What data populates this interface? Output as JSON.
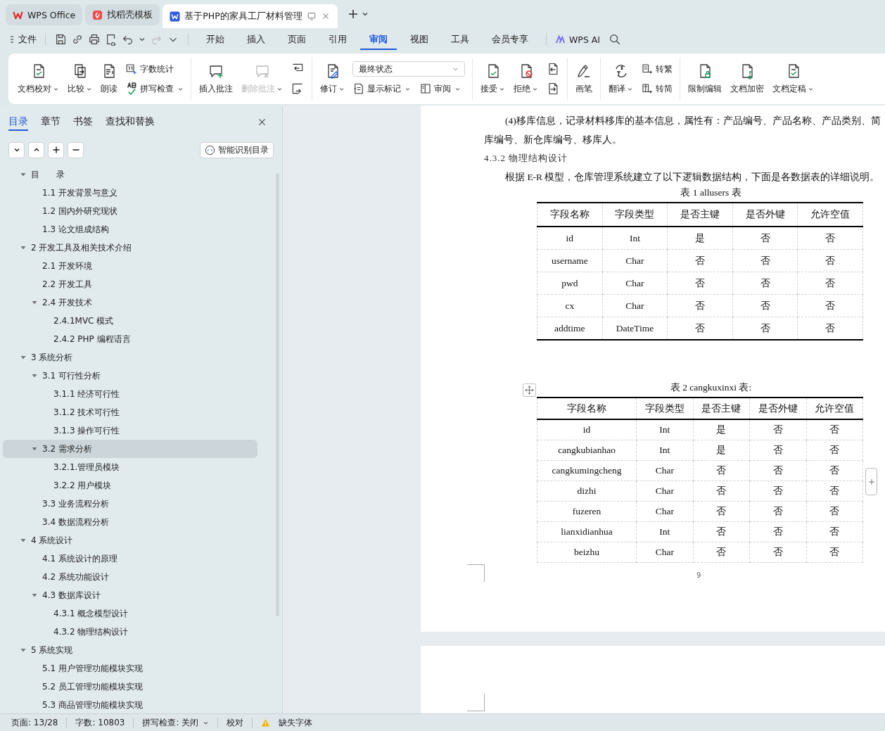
{
  "window_tabs": [
    {
      "label": "WPS Office",
      "kind": "home",
      "selected": false
    },
    {
      "label": "找稻壳模板",
      "kind": "template",
      "selected": false
    },
    {
      "label": "基于PHP的家具工厂材料管理",
      "kind": "document",
      "selected": true
    }
  ],
  "menu": {
    "file": "文件",
    "tabs": [
      {
        "label": "开始",
        "selected": false
      },
      {
        "label": "插入",
        "selected": false
      },
      {
        "label": "页面",
        "selected": false
      },
      {
        "label": "引用",
        "selected": false
      },
      {
        "label": "审阅",
        "selected": true
      },
      {
        "label": "视图",
        "selected": false
      },
      {
        "label": "工具",
        "selected": false
      },
      {
        "label": "会员专享",
        "selected": false
      }
    ],
    "ai": "WPS AI"
  },
  "ribbon": [
    {
      "items": [
        {
          "kind": "big",
          "label": "文档校对",
          "caret": true,
          "disabled": false
        },
        {
          "kind": "big",
          "label": "比较",
          "caret": true,
          "disabled": false
        },
        {
          "kind": "big",
          "label": "朗读",
          "caret": false,
          "disabled": false
        },
        {
          "kind": "small",
          "label": "字数统计",
          "caret": false,
          "disabled": false
        },
        {
          "kind": "small",
          "label": "拼写检查",
          "caret": true,
          "disabled": false
        }
      ]
    },
    {
      "items": [
        {
          "kind": "big",
          "label": "插入批注",
          "caret": false,
          "disabled": false
        },
        {
          "kind": "big",
          "label": "删除批注",
          "caret": true,
          "disabled": true
        },
        {
          "kind": "icon",
          "disabled": false
        },
        {
          "kind": "icon",
          "disabled": false
        }
      ]
    },
    {
      "items": [
        {
          "kind": "big",
          "label": "修订",
          "caret": true,
          "disabled": false
        },
        {
          "kind": "select",
          "label": "最终状态",
          "caret": true,
          "disabled": false
        },
        {
          "kind": "small",
          "label": "显示标记",
          "caret": true,
          "disabled": false
        },
        {
          "kind": "small",
          "label": "审阅",
          "caret": true,
          "disabled": false
        }
      ]
    },
    {
      "items": [
        {
          "kind": "big",
          "label": "接受",
          "caret": true,
          "disabled": false
        },
        {
          "kind": "big",
          "label": "拒绝",
          "caret": true,
          "disabled": false
        },
        {
          "kind": "icon",
          "disabled": false
        },
        {
          "kind": "icon",
          "disabled": false
        }
      ]
    },
    {
      "items": [
        {
          "kind": "big",
          "label": "画笔",
          "caret": false,
          "disabled": false
        }
      ]
    },
    {
      "items": [
        {
          "kind": "big",
          "label": "翻译",
          "caret": true,
          "disabled": false
        },
        {
          "kind": "small",
          "label": "转繁",
          "caret": false,
          "disabled": false
        },
        {
          "kind": "small",
          "label": "转简",
          "caret": false,
          "disabled": false
        }
      ]
    },
    {
      "items": [
        {
          "kind": "big",
          "label": "限制编辑",
          "caret": false,
          "disabled": false
        },
        {
          "kind": "big",
          "label": "文档加密",
          "caret": false,
          "disabled": false
        },
        {
          "kind": "big",
          "label": "文档定稿",
          "caret": true,
          "disabled": false
        }
      ]
    }
  ],
  "panel": {
    "tabs": [
      {
        "label": "目录",
        "selected": true
      },
      {
        "label": "章节",
        "selected": false
      },
      {
        "label": "书签",
        "selected": false
      },
      {
        "label": "查找和替换",
        "selected": false
      }
    ],
    "smart_button": "智能识别目录",
    "outline": [
      {
        "label": "目　　录",
        "expanded": true,
        "selected": false,
        "children": [
          {
            "label": "1.1 开发背景与意义",
            "selected": false
          },
          {
            "label": "1.2 国内外研究现状",
            "selected": false
          },
          {
            "label": "1.3 论文组成结构",
            "selected": false
          }
        ]
      },
      {
        "label": "2 开发工具及相关技术介绍",
        "expanded": true,
        "selected": false,
        "children": [
          {
            "label": "2.1 开发环境",
            "selected": false
          },
          {
            "label": "2.2 开发工具",
            "selected": false
          },
          {
            "label": "2.4 开发技术",
            "expanded": true,
            "selected": false,
            "children": [
              {
                "label": "2.4.1MVC 模式",
                "selected": false
              },
              {
                "label": "2.4.2 PHP 编程语言",
                "selected": false
              }
            ]
          }
        ]
      },
      {
        "label": "3 系统分析",
        "expanded": true,
        "selected": false,
        "children": [
          {
            "label": "3.1 可行性分析",
            "expanded": true,
            "selected": false,
            "children": [
              {
                "label": "3.1.1 经济可行性",
                "selected": false
              },
              {
                "label": "3.1.2 技术可行性",
                "selected": false
              },
              {
                "label": "3.1.3 操作可行性",
                "selected": false
              }
            ]
          },
          {
            "label": "3.2 需求分析",
            "expanded": true,
            "selected": true,
            "children": [
              {
                "label": "3.2.1.管理员模块",
                "selected": false
              },
              {
                "label": "3.2.2 用户模块",
                "selected": false
              }
            ]
          },
          {
            "label": "3.3 业务流程分析",
            "selected": false
          },
          {
            "label": "3.4 数据流程分析",
            "selected": false
          }
        ]
      },
      {
        "label": "4 系统设计",
        "expanded": true,
        "selected": false,
        "children": [
          {
            "label": "4.1 系统设计的原理",
            "selected": false
          },
          {
            "label": "4.2 系统功能设计",
            "selected": false
          },
          {
            "label": "4.3 数据库设计",
            "expanded": true,
            "selected": false,
            "children": [
              {
                "label": "4.3.1 概念模型设计",
                "selected": false
              },
              {
                "label": "4.3.2 物理结构设计",
                "selected": false
              }
            ]
          }
        ]
      },
      {
        "label": "5 系统实现",
        "expanded": true,
        "selected": false,
        "children": [
          {
            "label": "5.1 用户管理功能模块实现",
            "selected": false
          },
          {
            "label": "5.2 员工管理功能模块实现",
            "selected": false
          },
          {
            "label": "5.3 商品管理功能模块实现",
            "selected": false
          }
        ]
      }
    ]
  },
  "document": {
    "paragraph_lines": [
      "(4)移库信息，记录材料移库的基本信息，属性有：产品编号、产品名称、产品类别、简",
      "库编号、新仓库编号、移库人。"
    ],
    "heading": "4.3.2 物理结构设计",
    "intro": "根据 E-R 模型，仓库管理系统建立了以下逻辑数据结构，下面是各数据表的详细说明。",
    "tables": [
      {
        "caption": "表 1 allusers 表",
        "columns": [
          "字段名称",
          "字段类型",
          "是否主键",
          "是否外键",
          "允许空值"
        ],
        "rows": [
          [
            "id",
            "Int",
            "是",
            "否",
            "否"
          ],
          [
            "username",
            "Char",
            "否",
            "否",
            "否"
          ],
          [
            "pwd",
            "Char",
            "否",
            "否",
            "否"
          ],
          [
            "cx",
            "Char",
            "否",
            "否",
            "否"
          ],
          [
            "addtime",
            "DateTime",
            "否",
            "否",
            "否"
          ]
        ]
      },
      {
        "caption": "表 2 cangkuxinxi 表:",
        "columns": [
          "字段名称",
          "字段类型",
          "是否主键",
          "是否外键",
          "允许空值"
        ],
        "rows": [
          [
            "id",
            "Int",
            "是",
            "否",
            "否"
          ],
          [
            "cangkubianhao",
            "Int",
            "是",
            "否",
            "否"
          ],
          [
            "cangkumingcheng",
            "Char",
            "否",
            "否",
            "否"
          ],
          [
            "dizhi",
            "Char",
            "否",
            "否",
            "否"
          ],
          [
            "fuzeren",
            "Char",
            "否",
            "否",
            "否"
          ],
          [
            "lianxidianhua",
            "Int",
            "否",
            "否",
            "否"
          ],
          [
            "beizhu",
            "Char",
            "否",
            "否",
            "否"
          ]
        ]
      }
    ],
    "page_number": "9"
  },
  "status_bar": {
    "page": "页面: 13/28",
    "words": "字数: 10803",
    "spell": "拼写检查: 关闭",
    "proof": "校对",
    "missing_font": "缺失字体"
  }
}
